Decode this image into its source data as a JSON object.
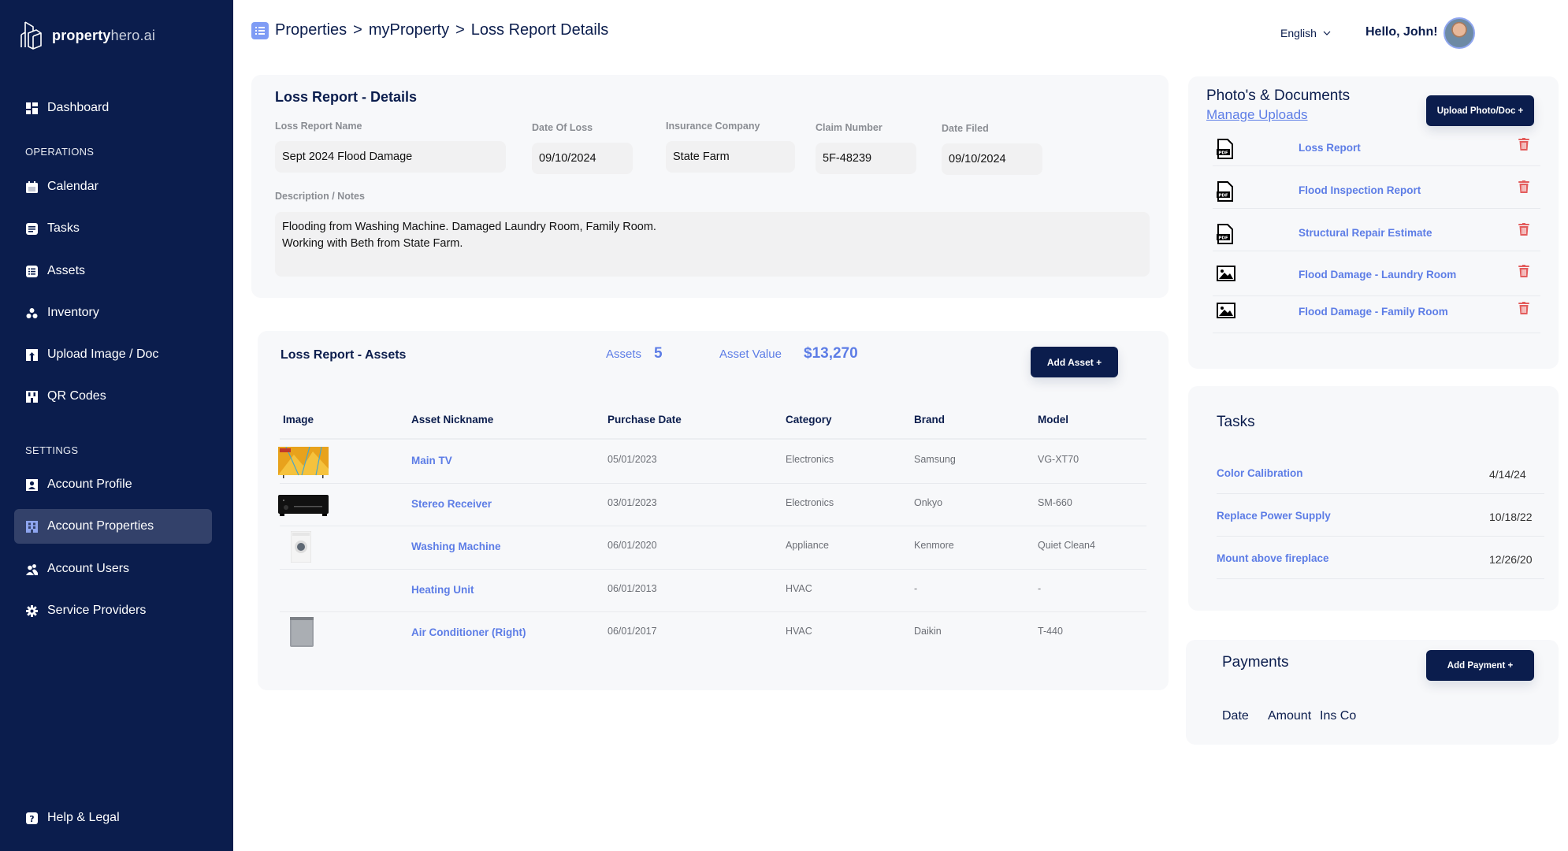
{
  "brand": {
    "bold": "property",
    "light": "hero.ai"
  },
  "sidebar": {
    "items": [
      {
        "label": "Dashboard",
        "icon": "dashboard-icon"
      },
      {
        "label": "Calendar",
        "icon": "calendar-icon"
      },
      {
        "label": "Tasks",
        "icon": "tasks-icon"
      },
      {
        "label": "Assets",
        "icon": "assets-list-icon"
      },
      {
        "label": "Inventory",
        "icon": "inventory-icon"
      },
      {
        "label": "Upload Image / Doc",
        "icon": "upload-icon"
      },
      {
        "label": "QR Codes",
        "icon": "qr-code-icon"
      },
      {
        "label": "Account Profile",
        "icon": "profile-icon"
      },
      {
        "label": "Account Properties",
        "icon": "building-icon",
        "active": true
      },
      {
        "label": "Account Users",
        "icon": "users-icon"
      },
      {
        "label": "Service Providers",
        "icon": "gear-icon"
      },
      {
        "label": "Help & Legal",
        "icon": "help-icon"
      }
    ],
    "sections": {
      "operations": "OPERATIONS",
      "settings": "SETTINGS"
    }
  },
  "header": {
    "breadcrumb": [
      "Properties",
      "myProperty",
      "Loss Report Details"
    ],
    "separator": ">",
    "language": "English",
    "greeting": "Hello, John!"
  },
  "details": {
    "title": "Loss Report - Details",
    "fields": {
      "name": {
        "label": "Loss Report Name",
        "value": "Sept 2024 Flood Damage"
      },
      "date_of_loss": {
        "label": "Date Of Loss",
        "value": "09/10/2024"
      },
      "insurance": {
        "label": "Insurance Company",
        "value": "State Farm"
      },
      "claim": {
        "label": "Claim Number",
        "value": "5F-48239"
      },
      "date_filed": {
        "label": "Date Filed",
        "value": "09/10/2024"
      }
    },
    "description": {
      "label": "Description / Notes",
      "value": "Flooding from Washing Machine.  Damaged Laundry Room, Family Room.\nWorking with Beth from State Farm."
    }
  },
  "assets": {
    "title": "Loss Report - Assets",
    "count_label": "Assets",
    "count": "5",
    "value_label": "Asset Value",
    "value": "$13,270",
    "add_button": "Add Asset +",
    "columns": [
      "Image",
      "Asset Nickname",
      "Purchase Date",
      "Category",
      "Brand",
      "Model"
    ],
    "rows": [
      {
        "image": "tv",
        "name": "Main TV",
        "date": "05/01/2023",
        "category": "Electronics",
        "brand": "Samsung",
        "model": "VG-XT70"
      },
      {
        "image": "receiver",
        "name": "Stereo Receiver",
        "date": "03/01/2023",
        "category": "Electronics",
        "brand": "Onkyo",
        "model": "SM-660"
      },
      {
        "image": "washer",
        "name": "Washing Machine",
        "date": "06/01/2020",
        "category": "Appliance",
        "brand": "Kenmore",
        "model": "Quiet Clean4"
      },
      {
        "image": "",
        "name": "Heating Unit",
        "date": "06/01/2013",
        "category": "HVAC",
        "brand": "-",
        "model": "-"
      },
      {
        "image": "ac",
        "name": "Air Conditioner (Right)",
        "date": "06/01/2017",
        "category": "HVAC",
        "brand": "Daikin",
        "model": "T-440"
      }
    ]
  },
  "documents": {
    "title": "Photo's & Documents",
    "manage_link": "Manage Uploads",
    "upload_button": "Upload Photo/Doc +",
    "items": [
      {
        "type": "pdf",
        "name": "Loss Report"
      },
      {
        "type": "pdf",
        "name": "Flood Inspection Report"
      },
      {
        "type": "pdf",
        "name": "Structural Repair Estimate"
      },
      {
        "type": "image",
        "name": "Flood Damage - Laundry Room"
      },
      {
        "type": "image",
        "name": "Flood Damage - Family Room"
      }
    ]
  },
  "tasks": {
    "title": "Tasks",
    "items": [
      {
        "name": "Color Calibration",
        "date": "4/14/24"
      },
      {
        "name": "Replace Power Supply",
        "date": "10/18/22"
      },
      {
        "name": "Mount above fireplace",
        "date": "12/26/20"
      }
    ]
  },
  "payments": {
    "title": "Payments",
    "add_button": "Add Payment +",
    "columns": [
      "Date",
      "Amount",
      "Ins Co"
    ]
  },
  "colors": {
    "navy": "#0b1d4d",
    "accent": "#5d7de6",
    "danger": "#e35d5d",
    "card": "#f7f8fa"
  }
}
